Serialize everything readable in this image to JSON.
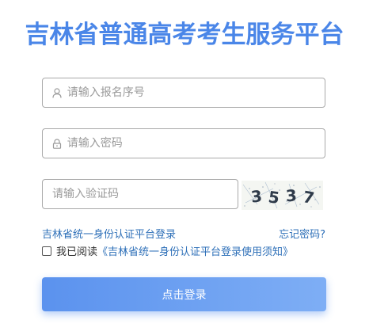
{
  "header": {
    "title": "吉林省普通高考考生服务平台"
  },
  "form": {
    "username_placeholder": "请输入报名序号",
    "username_icon": "user-icon",
    "password_placeholder": "请输入密码",
    "password_icon": "lock-icon",
    "captcha_placeholder": "请输入验证码",
    "captcha_text": "3537"
  },
  "links": {
    "login_link": "吉林省统一身份认证平台登录",
    "forgot_password": "忘记密码?"
  },
  "agreement": {
    "checked": false,
    "prefix": "我已阅读",
    "notice": "《吉林省统一身份认证平台登录使用须知》"
  },
  "actions": {
    "login_label": "点击登录"
  },
  "colors": {
    "title": "#4a86e8",
    "link": "#2d6fb8",
    "button_start": "#5b92ee",
    "button_end": "#7eaef5"
  }
}
